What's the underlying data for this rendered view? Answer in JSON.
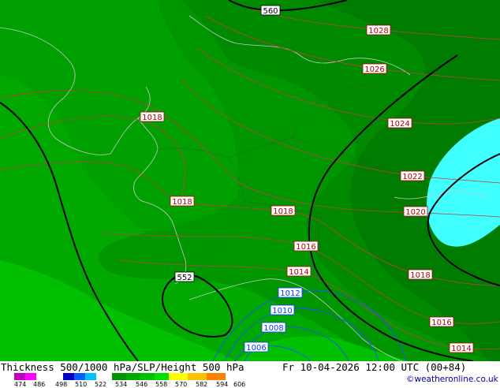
{
  "map": {
    "isobars_slp_hpa": [
      {
        "value": "1028",
        "color": "#b00000"
      },
      {
        "value": "1026",
        "color": "#b00000"
      },
      {
        "value": "1024",
        "color": "#b00000"
      },
      {
        "value": "1022",
        "color": "#b00000"
      },
      {
        "value": "1020",
        "color": "#b00000"
      },
      {
        "value": "1018",
        "color": "#b00000"
      },
      {
        "value": "1018",
        "color": "#b00000"
      },
      {
        "value": "1018",
        "color": "#b00000"
      },
      {
        "value": "1018",
        "color": "#b00000"
      },
      {
        "value": "1016",
        "color": "#b00000"
      },
      {
        "value": "1016",
        "color": "#b00000"
      },
      {
        "value": "1014",
        "color": "#b00000"
      },
      {
        "value": "1014",
        "color": "#b00000"
      },
      {
        "value": "1012",
        "color": "#0040ff"
      },
      {
        "value": "1010",
        "color": "#0040ff"
      },
      {
        "value": "1008",
        "color": "#0040ff"
      },
      {
        "value": "1006",
        "color": "#0040ff"
      }
    ],
    "height_500_labels": [
      "560",
      "552"
    ],
    "thickness_fill_colors": {
      "lowest": "#00c000",
      "light": "#00a800",
      "mid": "#009600",
      "dark": "#007c00",
      "cold_pool": "#40ffff"
    }
  },
  "footer": {
    "title": "Thickness 500/1000 hPa/SLP/Height 500 hPa",
    "valid_time": "Fr 10-04-2026 12:00 UTC (00+84)",
    "credit": "©weatheronline.co.uk",
    "scale_ticks": [
      "474",
      "486",
      "498",
      "510",
      "522",
      "534",
      "546",
      "558",
      "570",
      "582",
      "594",
      "606"
    ],
    "scale_colors": [
      "#c000c0",
      "#ff00ff",
      "#0000c0",
      "#0060ff",
      "#00c0ff",
      "#00c000",
      "#009600",
      "#00e000",
      "#ffff00",
      "#ffc000",
      "#ff8000",
      "#ffffff"
    ]
  }
}
